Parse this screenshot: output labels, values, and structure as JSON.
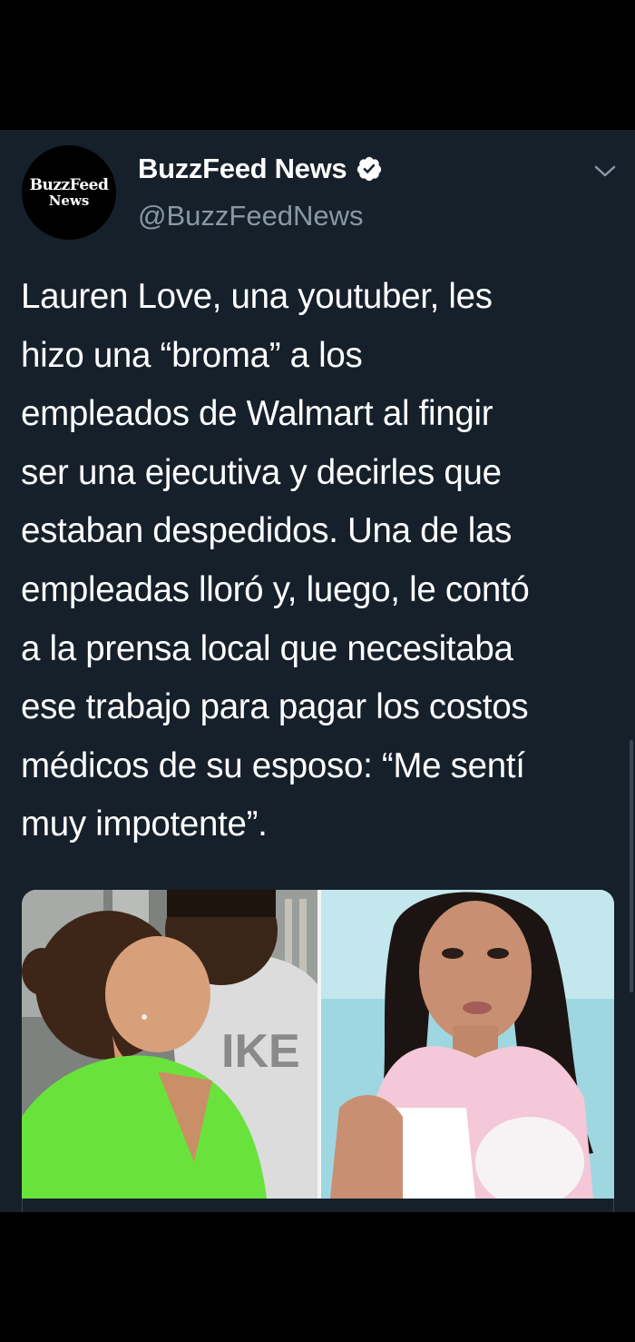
{
  "tweet": {
    "avatar_logo_line1": "BuzzFeed",
    "avatar_logo_line2": "News",
    "display_name": "BuzzFeed News",
    "handle": "@BuzzFeedNews",
    "verified": true,
    "text": "Lauren Love, una youtuber, les\nhizo una “broma” a los\nempleados de Walmart al fingir\nser una ejecutiva y decirles que\nestaban despedidos. Una de las\nempleadas lloró y, luego, le contó\na la prensa local que necesitaba\nese trabajo para pagar los costos\nmédicos de su esposo: “Me sentí\nmuy impotente”.",
    "media_left_shirt_text": "IKE"
  },
  "colors": {
    "background": "#15202b",
    "text": "#ffffff",
    "secondary_text": "#8899a6",
    "verified_badge": "#ffffff",
    "outer": "#000000"
  },
  "icons": {
    "verified": "verified-badge-icon",
    "menu": "chevron-down-icon"
  }
}
